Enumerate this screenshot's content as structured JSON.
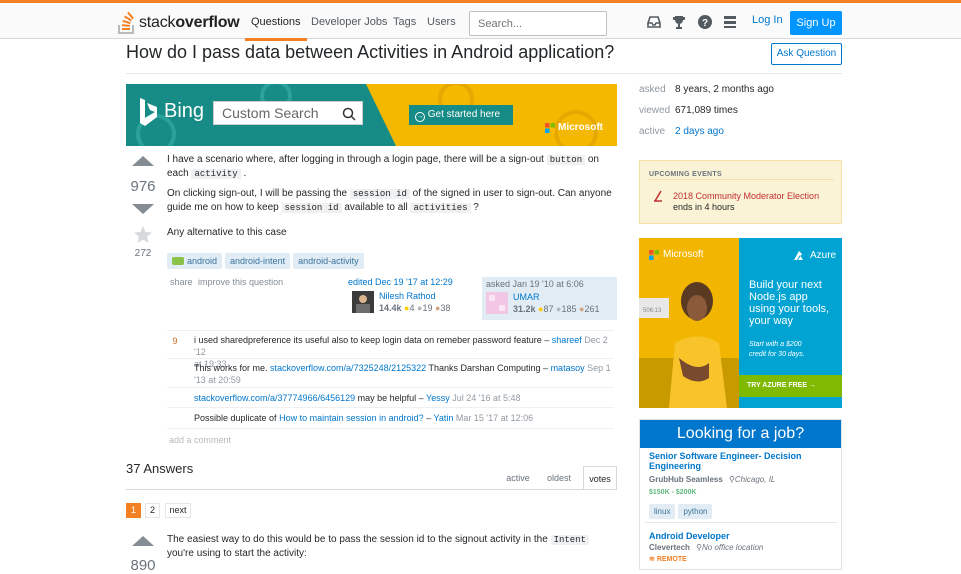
{
  "header": {
    "logo_light": "stack",
    "logo_bold": "overflow",
    "nav": [
      "Questions",
      "Developer Jobs",
      "Tags",
      "Users"
    ],
    "search_placeholder": "Search...",
    "login": "Log In",
    "signup": "Sign Up",
    "accent": "#f48024"
  },
  "question": {
    "title": "How do I pass data between Activities in Android application?",
    "ask_button": "Ask Question",
    "votes": "976",
    "favorites": "272",
    "p1a": "I have a scenario where, after logging in through a login page, there will be a sign-out",
    "p1code": "button",
    "p1b": "on",
    "p1c": "each",
    "p1code2": "activity",
    "p1d": ".",
    "p2a": "On clicking sign-out, I will be passing the",
    "p2code": "session id",
    "p2b": "of the signed in user to sign-out. Can anyone",
    "p2c": "guide me on how to keep",
    "p2code2": "session id",
    "p2d": "available to all",
    "p2code3": "activities",
    "p2e": "?",
    "p3": "Any alternative to this case",
    "tags": [
      "android",
      "android-intent",
      "android-activity"
    ],
    "share": "share",
    "improve": "improve this question",
    "edited_label": "edited Dec 19 '17 at 12:29",
    "editor_name": "Nilesh Rathod",
    "editor_rep": "14.4k",
    "editor_gold": "4",
    "editor_silver": "19",
    "editor_bronze": "38",
    "asked_label": "asked Jan 19 '10 at 6:06",
    "asker_name": "UMAR",
    "asker_rep": "31.2k",
    "asker_gold": "87",
    "asker_silver": "185",
    "asker_bronze": "261"
  },
  "banner": {
    "brand": "Bing",
    "search_text": "Custom Search",
    "cta": "Get started here",
    "sponsor": "Microsoft"
  },
  "stats": {
    "asked_label": "asked",
    "asked_value": "8 years, 2 months ago",
    "viewed_label": "viewed",
    "viewed_value": "671,089 times",
    "active_label": "active",
    "active_value": "2 days ago"
  },
  "events": {
    "heading": "UPCOMING EVENTS",
    "title": "2018 Community Moderator Election",
    "subtitle": "ends in 4 hours"
  },
  "comments": [
    {
      "score": "9",
      "text": "i used sharedpreference its useful also to keep login data on remeber password feature –",
      "user": "shareef",
      "date": "Dec 2 '12",
      "date2": "at 19:33"
    },
    {
      "score": "",
      "text": "This works for me.",
      "link": "stackoverflow.com/a/7325248/2125322",
      "text2": "Thanks Darshan Computing –",
      "user": "matasoy",
      "date": "Sep 1",
      "date2": "'13 at 20:59"
    },
    {
      "score": "",
      "link": "stackoverflow.com/a/37774966/6456129",
      "text2": "may be helpful –",
      "user": "Yessy",
      "date": "Jul 24 '16 at 5:48"
    },
    {
      "score": "",
      "text": "Possible duplicate of",
      "link": "How to maintain session in android?",
      "text2": "–",
      "user": "Yatin",
      "date": "Mar 15 '17 at 12:06"
    }
  ],
  "add_comment": "add a comment",
  "answers": {
    "count_label": "37 Answers",
    "tabs": [
      "active",
      "oldest",
      "votes"
    ],
    "pages": [
      "1",
      "2",
      "next"
    ],
    "first_votes": "890",
    "first_a": "The easiest way to do this would be to pass the session id to the signout activity in the",
    "first_code": "Intent",
    "first_b": "you're using to start the activity:"
  },
  "azure_ad": {
    "brand": "Microsoft",
    "product": "Azure",
    "headline": [
      "Build your next",
      "Node.js app",
      "using your tools,",
      "your way"
    ],
    "offer": [
      "Start with a $200",
      "credit for 30 days."
    ],
    "cta": "TRY AZURE FREE →"
  },
  "jobs": {
    "heading": "Looking for a job?",
    "items": [
      {
        "title": "Senior Software Engineer- Decision Engineering",
        "company": "GrubHub Seamless",
        "location": "Chicago, IL",
        "salary": "$150K - $200K",
        "tags": [
          "linux",
          "python"
        ]
      },
      {
        "title": "Android Developer",
        "company": "Clevertech",
        "location": "No office location",
        "remote": "REMOTE"
      }
    ]
  }
}
